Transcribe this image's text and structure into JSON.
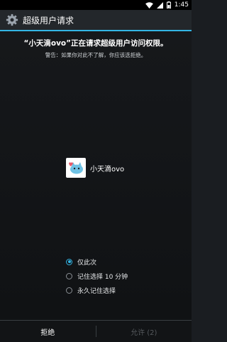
{
  "status_bar": {
    "time": "1:45",
    "icons": [
      "wifi-icon",
      "signal-icon",
      "battery-icon"
    ]
  },
  "title_bar": {
    "title": "超级用户请求",
    "icon": "gear-icon"
  },
  "dialog": {
    "headline": "“小天滴ovo”正在请求超级用户访问权限。",
    "warning": "警告：如果你对此不了解，你应该选拒绝。",
    "app": {
      "name": "小天滴ovo",
      "icon": "app-icon"
    },
    "options": [
      {
        "label": "仅此次",
        "selected": true
      },
      {
        "label": "记住选择 10 分钟",
        "selected": false
      },
      {
        "label": "永久记住选择",
        "selected": false
      }
    ]
  },
  "buttons": {
    "deny_label": "拒绝",
    "allow_label": "允许 (2)"
  },
  "colors": {
    "accent": "#33b5e5",
    "background": "#16181b",
    "disabled_text": "#55595d"
  }
}
